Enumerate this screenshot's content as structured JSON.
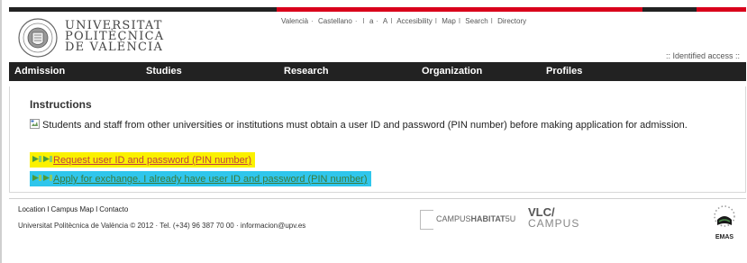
{
  "header": {
    "university_name": [
      "UNIVERSITAT",
      "POLITÈCNICA",
      "DE VALÈNCIA"
    ],
    "top_links": [
      "Valencià",
      "Castellano",
      "a",
      "A",
      "Accesibility",
      "Map",
      "Search",
      "Directory"
    ],
    "identified_access": ":: Identified access ::"
  },
  "nav": {
    "items": [
      "Admission",
      "Studies",
      "Research",
      "Organization",
      "Profiles"
    ]
  },
  "main": {
    "title": "Instructions",
    "text": "Students and staff from other universities or institutions must obtain a user ID and password (PIN number) before making application for admission.",
    "links": [
      {
        "label": "Request user ID and password (PIN number)",
        "highlight": "#fbf100"
      },
      {
        "label": "Apply for exchange. I already have user ID and password (PIN number)",
        "highlight": "#2fc6ec"
      }
    ]
  },
  "footer": {
    "links": [
      "Location",
      "Campus Map",
      "Contacto"
    ],
    "copyright": "Universitat Politècnica de València © 2012 · Tel. (+34) 96 387 70 00 · informacion@upv.es",
    "campus_habitat": {
      "prefix": "CAMPUS",
      "bold": "HABITAT",
      "suffix": "5U"
    },
    "vlc": {
      "line1": "VLC/",
      "line2": "CAMPUS"
    },
    "emas": "EMAS"
  },
  "colors": {
    "nav_bg": "#222222",
    "accent_red": "#d9001b",
    "highlight_yellow": "#fbf100",
    "highlight_blue": "#2fc6ec"
  }
}
